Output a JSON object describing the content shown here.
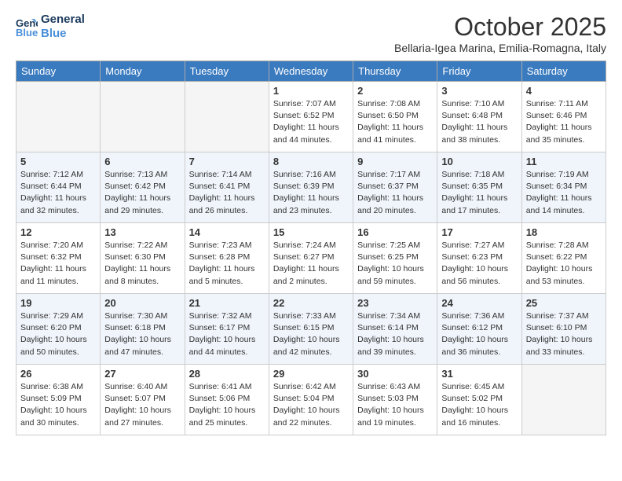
{
  "header": {
    "logo_line1": "General",
    "logo_line2": "Blue",
    "month": "October 2025",
    "location": "Bellaria-Igea Marina, Emilia-Romagna, Italy"
  },
  "days_of_week": [
    "Sunday",
    "Monday",
    "Tuesday",
    "Wednesday",
    "Thursday",
    "Friday",
    "Saturday"
  ],
  "weeks": [
    [
      {
        "day": "",
        "info": ""
      },
      {
        "day": "",
        "info": ""
      },
      {
        "day": "",
        "info": ""
      },
      {
        "day": "1",
        "info": "Sunrise: 7:07 AM\nSunset: 6:52 PM\nDaylight: 11 hours and 44 minutes."
      },
      {
        "day": "2",
        "info": "Sunrise: 7:08 AM\nSunset: 6:50 PM\nDaylight: 11 hours and 41 minutes."
      },
      {
        "day": "3",
        "info": "Sunrise: 7:10 AM\nSunset: 6:48 PM\nDaylight: 11 hours and 38 minutes."
      },
      {
        "day": "4",
        "info": "Sunrise: 7:11 AM\nSunset: 6:46 PM\nDaylight: 11 hours and 35 minutes."
      }
    ],
    [
      {
        "day": "5",
        "info": "Sunrise: 7:12 AM\nSunset: 6:44 PM\nDaylight: 11 hours and 32 minutes."
      },
      {
        "day": "6",
        "info": "Sunrise: 7:13 AM\nSunset: 6:42 PM\nDaylight: 11 hours and 29 minutes."
      },
      {
        "day": "7",
        "info": "Sunrise: 7:14 AM\nSunset: 6:41 PM\nDaylight: 11 hours and 26 minutes."
      },
      {
        "day": "8",
        "info": "Sunrise: 7:16 AM\nSunset: 6:39 PM\nDaylight: 11 hours and 23 minutes."
      },
      {
        "day": "9",
        "info": "Sunrise: 7:17 AM\nSunset: 6:37 PM\nDaylight: 11 hours and 20 minutes."
      },
      {
        "day": "10",
        "info": "Sunrise: 7:18 AM\nSunset: 6:35 PM\nDaylight: 11 hours and 17 minutes."
      },
      {
        "day": "11",
        "info": "Sunrise: 7:19 AM\nSunset: 6:34 PM\nDaylight: 11 hours and 14 minutes."
      }
    ],
    [
      {
        "day": "12",
        "info": "Sunrise: 7:20 AM\nSunset: 6:32 PM\nDaylight: 11 hours and 11 minutes."
      },
      {
        "day": "13",
        "info": "Sunrise: 7:22 AM\nSunset: 6:30 PM\nDaylight: 11 hours and 8 minutes."
      },
      {
        "day": "14",
        "info": "Sunrise: 7:23 AM\nSunset: 6:28 PM\nDaylight: 11 hours and 5 minutes."
      },
      {
        "day": "15",
        "info": "Sunrise: 7:24 AM\nSunset: 6:27 PM\nDaylight: 11 hours and 2 minutes."
      },
      {
        "day": "16",
        "info": "Sunrise: 7:25 AM\nSunset: 6:25 PM\nDaylight: 10 hours and 59 minutes."
      },
      {
        "day": "17",
        "info": "Sunrise: 7:27 AM\nSunset: 6:23 PM\nDaylight: 10 hours and 56 minutes."
      },
      {
        "day": "18",
        "info": "Sunrise: 7:28 AM\nSunset: 6:22 PM\nDaylight: 10 hours and 53 minutes."
      }
    ],
    [
      {
        "day": "19",
        "info": "Sunrise: 7:29 AM\nSunset: 6:20 PM\nDaylight: 10 hours and 50 minutes."
      },
      {
        "day": "20",
        "info": "Sunrise: 7:30 AM\nSunset: 6:18 PM\nDaylight: 10 hours and 47 minutes."
      },
      {
        "day": "21",
        "info": "Sunrise: 7:32 AM\nSunset: 6:17 PM\nDaylight: 10 hours and 44 minutes."
      },
      {
        "day": "22",
        "info": "Sunrise: 7:33 AM\nSunset: 6:15 PM\nDaylight: 10 hours and 42 minutes."
      },
      {
        "day": "23",
        "info": "Sunrise: 7:34 AM\nSunset: 6:14 PM\nDaylight: 10 hours and 39 minutes."
      },
      {
        "day": "24",
        "info": "Sunrise: 7:36 AM\nSunset: 6:12 PM\nDaylight: 10 hours and 36 minutes."
      },
      {
        "day": "25",
        "info": "Sunrise: 7:37 AM\nSunset: 6:10 PM\nDaylight: 10 hours and 33 minutes."
      }
    ],
    [
      {
        "day": "26",
        "info": "Sunrise: 6:38 AM\nSunset: 5:09 PM\nDaylight: 10 hours and 30 minutes."
      },
      {
        "day": "27",
        "info": "Sunrise: 6:40 AM\nSunset: 5:07 PM\nDaylight: 10 hours and 27 minutes."
      },
      {
        "day": "28",
        "info": "Sunrise: 6:41 AM\nSunset: 5:06 PM\nDaylight: 10 hours and 25 minutes."
      },
      {
        "day": "29",
        "info": "Sunrise: 6:42 AM\nSunset: 5:04 PM\nDaylight: 10 hours and 22 minutes."
      },
      {
        "day": "30",
        "info": "Sunrise: 6:43 AM\nSunset: 5:03 PM\nDaylight: 10 hours and 19 minutes."
      },
      {
        "day": "31",
        "info": "Sunrise: 6:45 AM\nSunset: 5:02 PM\nDaylight: 10 hours and 16 minutes."
      },
      {
        "day": "",
        "info": ""
      }
    ]
  ]
}
